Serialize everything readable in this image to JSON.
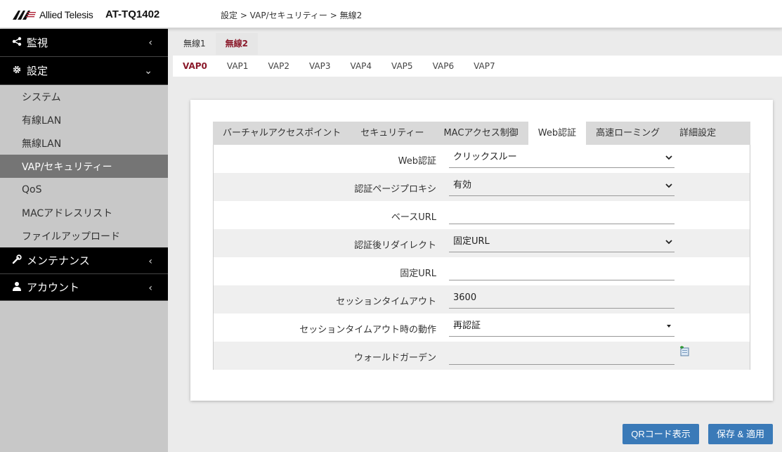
{
  "header": {
    "brand": "Allied Telesis",
    "model": "AT-TQ1402",
    "breadcrumb": "設定 > VAP/セキュリティー > 無線2"
  },
  "sidebar": {
    "monitor": {
      "label": "監視",
      "icon": "share-icon"
    },
    "settings": {
      "label": "設定",
      "icon": "gear-icon"
    },
    "settings_items": [
      "システム",
      "有線LAN",
      "無線LAN",
      "VAP/セキュリティー",
      "QoS",
      "MACアドレスリスト",
      "ファイルアップロード"
    ],
    "active_item": "VAP/セキュリティー",
    "maintenance": {
      "label": "メンテナンス",
      "icon": "wrench-icon"
    },
    "account": {
      "label": "アカウント",
      "icon": "user-icon"
    }
  },
  "wireless_tabs": [
    "無線1",
    "無線2"
  ],
  "wireless_active": "無線2",
  "vap_tabs": [
    "VAP0",
    "VAP1",
    "VAP2",
    "VAP3",
    "VAP4",
    "VAP5",
    "VAP6",
    "VAP7"
  ],
  "vap_active": "VAP0",
  "inner_tabs": [
    "バーチャルアクセスポイント",
    "セキュリティー",
    "MACアクセス制御",
    "Web認証",
    "高速ローミング",
    "詳細設定"
  ],
  "inner_active": "Web認証",
  "form": {
    "web_auth": {
      "label": "Web認証",
      "value": "クリックスルー"
    },
    "page_proxy": {
      "label": "認証ページプロキシ",
      "value": "有効"
    },
    "base_url": {
      "label": "ベースURL",
      "value": ""
    },
    "redirect": {
      "label": "認証後リダイレクト",
      "value": "固定URL"
    },
    "fixed_url": {
      "label": "固定URL",
      "value": ""
    },
    "session_timeout": {
      "label": "セッションタイムアウト",
      "value": "3600"
    },
    "timeout_action": {
      "label": "セッションタイムアウト時の動作",
      "value": "再認証"
    },
    "walled_garden": {
      "label": "ウォールドガーデン",
      "value": ""
    }
  },
  "buttons": {
    "qr": "QRコード表示",
    "save": "保存 & 適用"
  },
  "colors": {
    "accent": "#8b1a2b",
    "button": "#3a7ab8",
    "sidebar_dark": "#000000",
    "sidebar_bg": "#c8c8c8",
    "sidebar_active": "#757575"
  }
}
